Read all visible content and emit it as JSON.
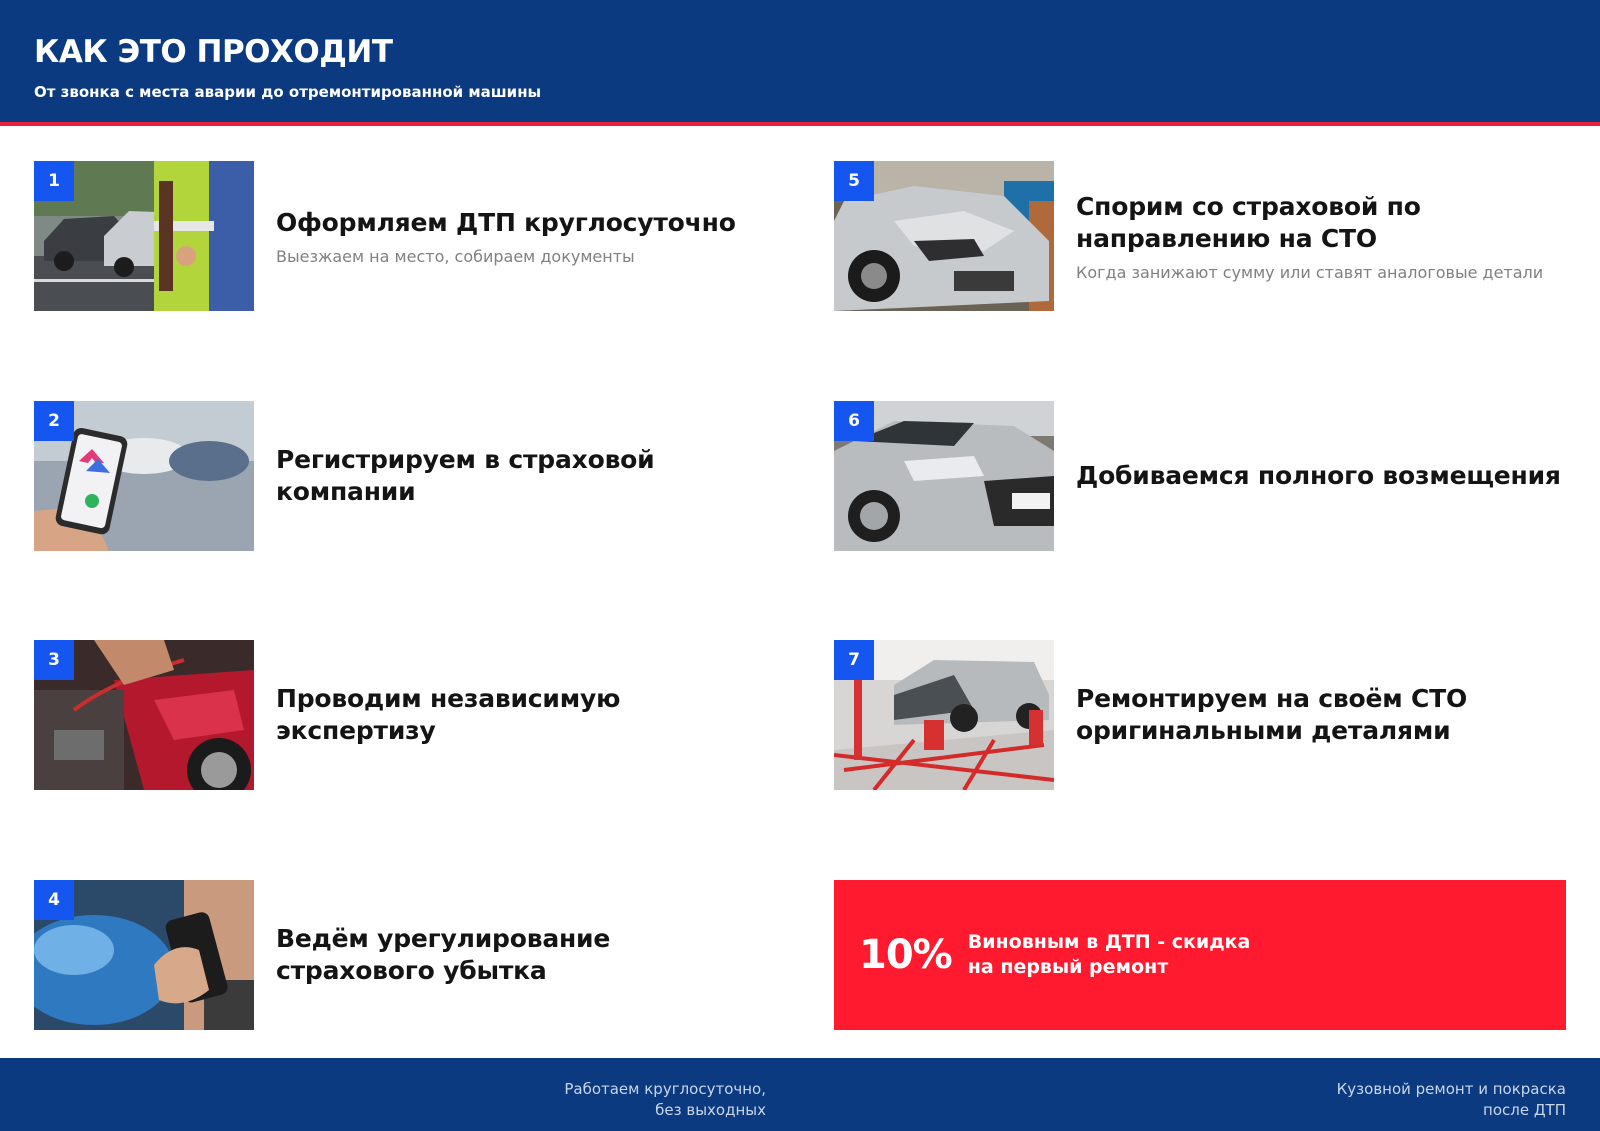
{
  "header": {
    "title": "КАК ЭТО ПРОХОДИТ",
    "subtitle": "От звонка с места аварии до отремонтированной машины"
  },
  "steps": [
    {
      "num": "1",
      "title": "Оформляем ДТП круглосуточно",
      "desc": "Выезжаем на место, собираем документы"
    },
    {
      "num": "2",
      "title": "Регистрируем в страховой компании",
      "desc": ""
    },
    {
      "num": "3",
      "title": "Проводим независимую экспертизу",
      "desc": ""
    },
    {
      "num": "4",
      "title": "Ведём урегулирование страхового убытка",
      "desc": ""
    },
    {
      "num": "5",
      "title": "Спорим со страховой по направлению на СТО",
      "desc": "Когда занижают сумму или ставят аналоговые детали"
    },
    {
      "num": "6",
      "title": "Добиваемся полного возмещения",
      "desc": ""
    },
    {
      "num": "7",
      "title": "Ремонтируем на своём СТО оригинальными деталями",
      "desc": ""
    }
  ],
  "promo": {
    "percent": "10%",
    "line1": "Виновным в ДТП - скидка",
    "line2": "на первый ремонт"
  },
  "footer": {
    "note_left_line1": "Работаем круглосуточно,",
    "note_left_line2": "без выходных",
    "note_right_line1": "Кузовной ремонт и покраска",
    "note_right_line2": "после ДТП"
  },
  "colors": {
    "brand_blue": "#0b3a80",
    "badge_blue": "#1656f0",
    "accent_red": "#ff1a2f"
  },
  "icons": {
    "step1": "accident-police-photo",
    "step2": "phone-app-photo",
    "step3": "expert-inspection-photo",
    "step4": "phone-call-photo",
    "step5": "damaged-car-photo",
    "step6": "silver-car-photo",
    "step7": "repair-shop-photo"
  }
}
